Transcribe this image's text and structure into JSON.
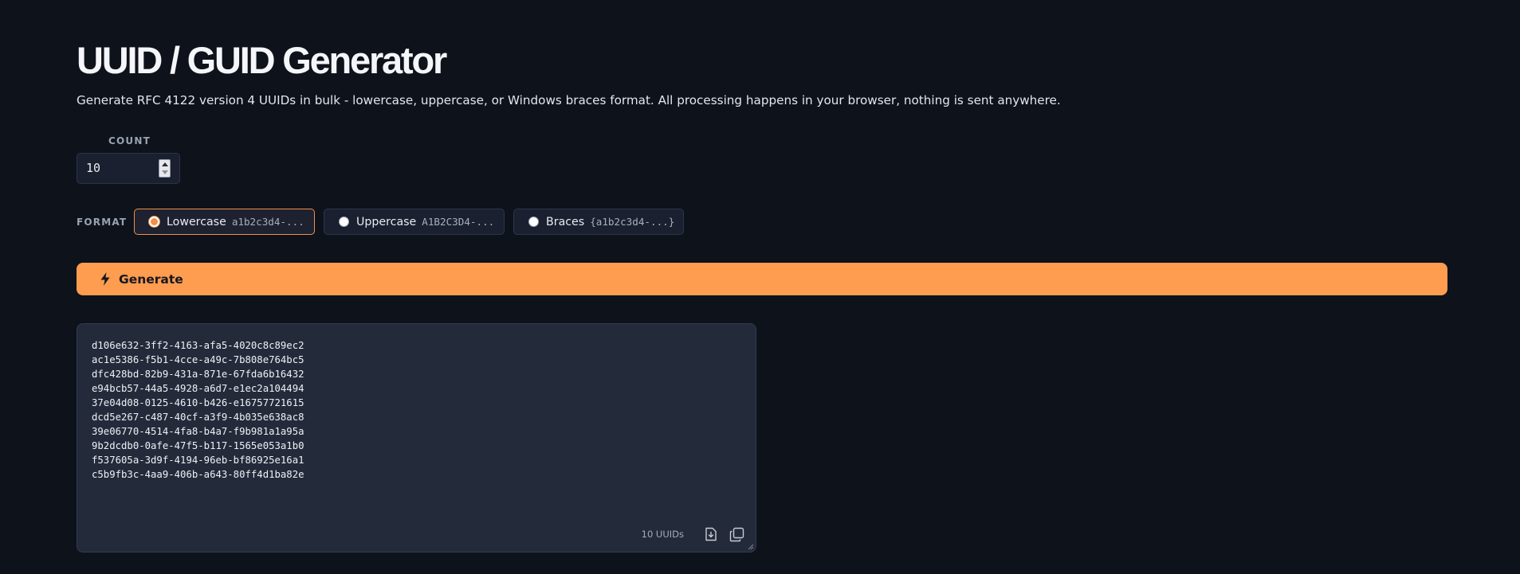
{
  "header": {
    "title": "UUID / GUID Generator",
    "subtitle": "Generate RFC 4122 version 4 UUIDs in bulk - lowercase, uppercase, or Windows braces format. All processing happens in your browser, nothing is sent anywhere."
  },
  "count": {
    "label": "COUNT",
    "value": "10"
  },
  "format": {
    "label": "FORMAT",
    "selected": "lowercase",
    "options": [
      {
        "label": "Lowercase",
        "example": "a1b2c3d4-..."
      },
      {
        "label": "Uppercase",
        "example": "A1B2C3D4-..."
      },
      {
        "label": "Braces",
        "example": "{a1b2c3d4-...}"
      }
    ]
  },
  "generate": {
    "label": "Generate",
    "icon": "lightning-bolt-icon"
  },
  "output": {
    "uuids": [
      "d106e632-3ff2-4163-afa5-4020c8c89ec2",
      "ac1e5386-f5b1-4cce-a49c-7b808e764bc5",
      "dfc428bd-82b9-431a-871e-67fda6b16432",
      "e94bcb57-44a5-4928-a6d7-e1ec2a104494",
      "37e04d08-0125-4610-b426-e16757721615",
      "dcd5e267-c487-40cf-a3f9-4b035e638ac8",
      "39e06770-4514-4fa8-b4a7-f9b981a1a95a",
      "9b2dcdb0-0afe-47f5-b117-1565e053a1b0",
      "f537605a-3d9f-4194-96eb-bf86925e16a1",
      "c5b9fb3c-4aa9-406b-a643-80ff4d1ba82e"
    ],
    "count_label": "10 UUIDs",
    "download_icon": "download-icon",
    "copy_icon": "copy-icon"
  },
  "colors": {
    "background": "#0e121b",
    "accent": "#fe9c50",
    "panel": "#232b3b"
  }
}
